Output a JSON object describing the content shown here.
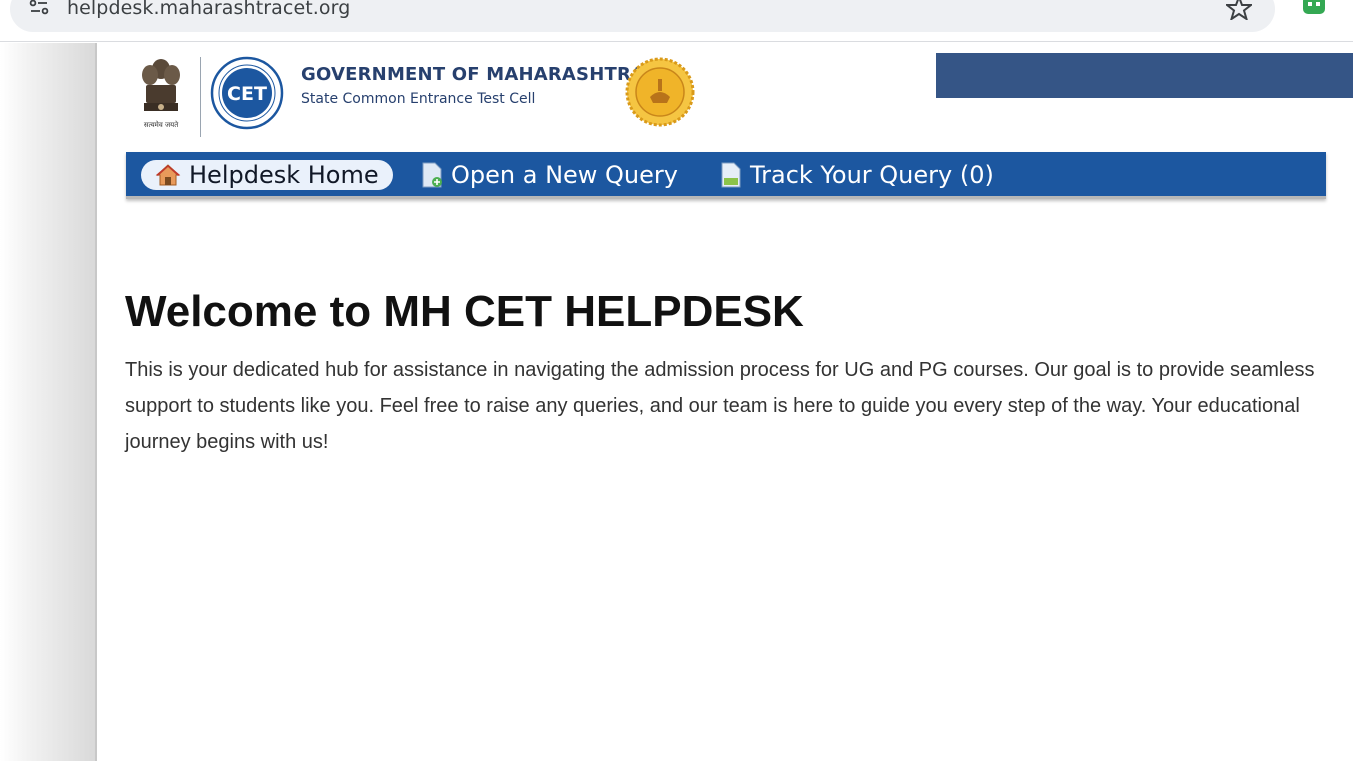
{
  "browser": {
    "url": "helpdesk.maharashtracet.org"
  },
  "header": {
    "title": "GOVERNMENT OF MAHARASHTRA",
    "subtitle": "State Common Entrance Test Cell",
    "cet_logo_text": "CET",
    "emblem_caption": "सत्यमेव जयते"
  },
  "nav": {
    "items": [
      {
        "label": "Helpdesk Home",
        "icon": "home-icon",
        "active": true
      },
      {
        "label": "Open a New Query",
        "icon": "new-document-icon",
        "active": false
      },
      {
        "label": "Track Your Query (0)",
        "icon": "document-icon",
        "active": false
      }
    ]
  },
  "main": {
    "heading": "Welcome to MH CET HELPDESK",
    "body": "This is your dedicated hub for assistance in navigating the admission process for UG and PG courses. Our goal is to provide seamless support to students like you. Feel free to raise any queries, and our team is here to guide you every step of the way. Your educational journey begins with us!"
  },
  "colors": {
    "nav_background": "#1c57a0",
    "header_text": "#27406e",
    "banner": "#355586",
    "seal_gold": "#f0b429"
  }
}
